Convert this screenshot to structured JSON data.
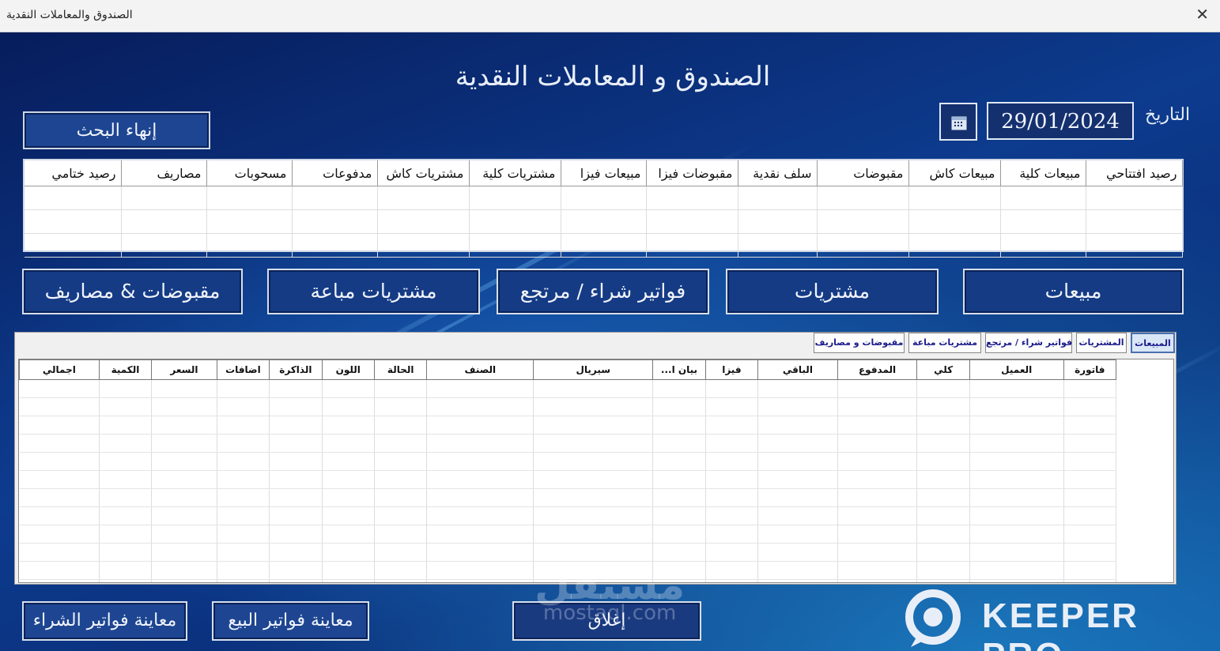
{
  "window": {
    "title": "الصندوق والمعاملات النقدية",
    "close_glyph": "✕"
  },
  "heading": "الصندوق و المعاملات النقدية",
  "date": {
    "label": "التاريخ",
    "value": "29/01/2024"
  },
  "end_search_label": "إنهاء البحث",
  "summary_columns": [
    "رصيد افتتاحي",
    "مبيعات كلية",
    "مبيعات كاش",
    "مقبوضات",
    "سلف نقدية",
    "مقبوضات فيزا",
    "مبيعات فيزا",
    "مشتريات كلية",
    "مشتريات كاش",
    "مدفوعات",
    "مسحوبات",
    "مصاريف",
    "رصيد ختامي"
  ],
  "nav_buttons": {
    "sales": "مبيعات",
    "purchases": "مشتريات",
    "purchase_invoices": "فواتير شراء / مرتجع",
    "sold_purchases": "مشتريات مباعة",
    "receipts_expenses": "مقبوضات & مصاريف"
  },
  "tabs": [
    "المبيعات",
    "المشتريات",
    "فواتير شراء / مرتجع",
    "مشتريات مباعة",
    "مقبوضات و مصاريف"
  ],
  "grid_columns": [
    "فاتورة",
    "العميل",
    "كلي",
    "المدفوع",
    "الباقي",
    "فيزا",
    "بيان ا...",
    "سيريال",
    "الصنف",
    "الحالة",
    "اللون",
    "الذاكرة",
    "اضافات",
    "السعر",
    "الكمية",
    "اجمالي"
  ],
  "bottom_buttons": {
    "close": "إغلاق",
    "view_sales": "معاينة فواتير البيع",
    "view_purchases": "معاينة فواتير الشراء"
  },
  "brand": "KEEPER PRO",
  "watermark": {
    "arabic": "مستقل",
    "latin": "mostaql.com"
  },
  "colors": {
    "background": "#0d3b8e",
    "button": "#153b85",
    "tab_active": "#d8e6f6"
  },
  "icons": {
    "calendar": "calendar-icon",
    "close": "close-icon",
    "logo": "keeper-logo-icon"
  }
}
